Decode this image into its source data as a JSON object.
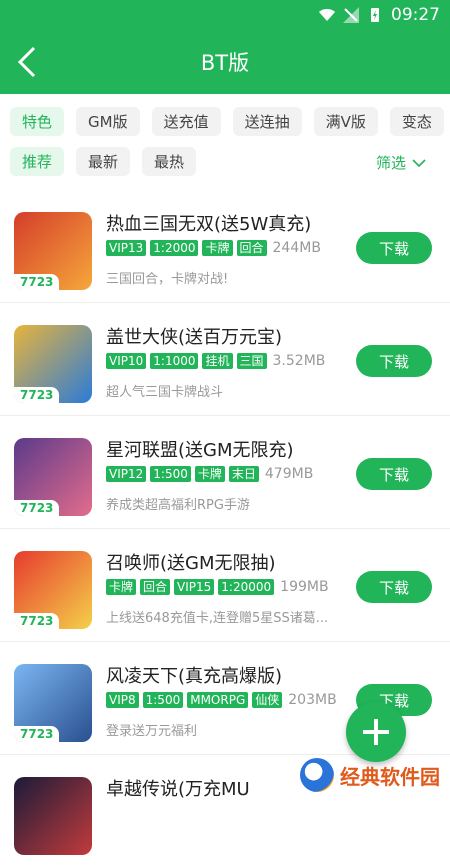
{
  "statusbar": {
    "time": "09:27"
  },
  "appbar": {
    "title": "BT版"
  },
  "categories": [
    "特色",
    "GM版",
    "送充值",
    "送连抽",
    "满V版",
    "变态"
  ],
  "sort": {
    "options": [
      "推荐",
      "最新",
      "最热"
    ],
    "filter_label": "筛选"
  },
  "games": [
    {
      "name": "热血三国无双(送5W真充)",
      "tags": [
        "VIP13",
        "1:2000",
        "卡牌",
        "回合"
      ],
      "size": "244MB",
      "desc": "三国回合，卡牌对战!",
      "button": "下载",
      "thumb_tag": "7723"
    },
    {
      "name": "盖世大侠(送百万元宝)",
      "tags": [
        "VIP10",
        "1:1000",
        "挂机",
        "三国"
      ],
      "size": "3.52MB",
      "desc": "超人气三国卡牌战斗",
      "button": "下载",
      "thumb_tag": "7723"
    },
    {
      "name": "星河联盟(送GM无限充)",
      "tags": [
        "VIP12",
        "1:500",
        "卡牌",
        "末日"
      ],
      "size": "479MB",
      "desc": "养成类超高福利RPG手游",
      "button": "下载",
      "thumb_tag": "7723"
    },
    {
      "name": "召唤师(送GM无限抽)",
      "tags": [
        "卡牌",
        "回合",
        "VIP15",
        "1:20000"
      ],
      "size": "199MB",
      "desc": "上线送648充值卡,连登赠5星SS诸葛...",
      "button": "下载",
      "thumb_tag": "7723"
    },
    {
      "name": "风凌天下(真充高爆版)",
      "tags": [
        "VIP8",
        "1:500",
        "MMORPG",
        "仙侠"
      ],
      "size": "203MB",
      "desc": "登录送万元福利",
      "button": "下载",
      "thumb_tag": "7723"
    },
    {
      "name": "卓越传说(万充MU",
      "tags": [],
      "size": "",
      "desc": "",
      "button": "",
      "thumb_tag": ""
    }
  ],
  "fab": {
    "icon": "plus-icon"
  },
  "watermark": {
    "text": "经典软件园"
  },
  "colors": {
    "primary": "#21b459"
  }
}
